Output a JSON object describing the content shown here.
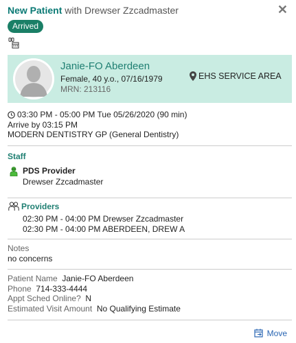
{
  "header": {
    "title_bold": "New Patient",
    "title_rest": " with Drewser Zzcadmaster",
    "close_glyph": "✕"
  },
  "status_badge": "Arrived",
  "patient": {
    "name": "Janie-FO Aberdeen",
    "info": "Female, 40 y.o., 07/16/1979",
    "mrn": "MRN: 213116",
    "location": "EHS SERVICE AREA"
  },
  "appointment": {
    "time": "03:30 PM - 05:00 PM  Tue 05/26/2020  (90 min)",
    "arrive_by": "Arrive by 03:15 PM",
    "department": "MODERN DENTISTRY GP (General Dentistry)"
  },
  "staff": {
    "section_title": "Staff",
    "role": "PDS Provider",
    "name": "Drewser Zzcadmaster"
  },
  "providers": {
    "section_title": "Providers",
    "rows": [
      "02:30 PM - 04:00 PM Drewser Zzcadmaster",
      "02:30 PM - 04:00 PM ABERDEEN, DREW A"
    ]
  },
  "notes": {
    "label": "Notes",
    "value": "no concerns"
  },
  "details": {
    "patient_name_label": "Patient Name",
    "patient_name_value": "Janie-FO Aberdeen",
    "phone_label": "Phone",
    "phone_value": "714-333-4444",
    "appt_online_label": "Appt Sched Online?",
    "appt_online_value": "N",
    "estimate_label": "Estimated Visit Amount",
    "estimate_value": "No Qualifying Estimate"
  },
  "actions": {
    "move_label": "Move"
  },
  "colors": {
    "accent": "#1f7f72",
    "badge": "#1a7f66",
    "card_bg": "#c9ece2",
    "link": "#2a66b3"
  }
}
